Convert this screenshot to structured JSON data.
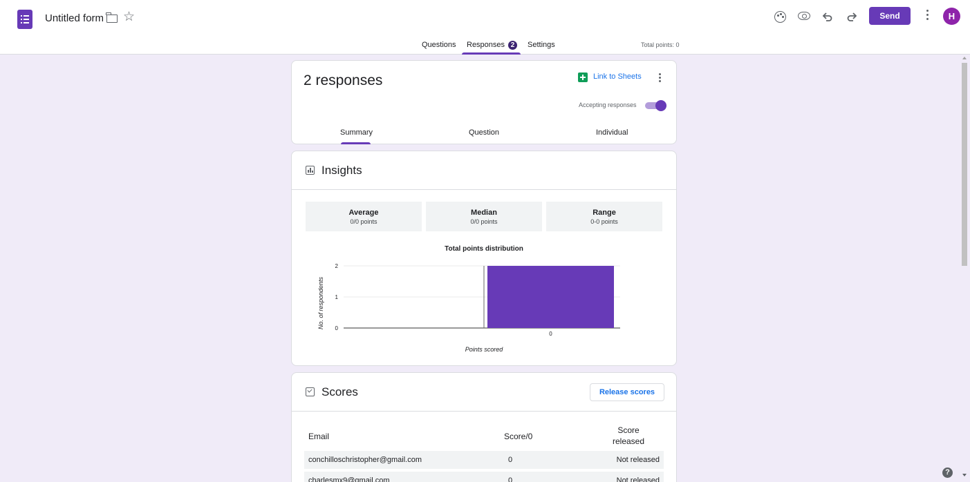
{
  "header": {
    "form_title": "Untitled form",
    "send_label": "Send",
    "avatar_initial": "H"
  },
  "nav": {
    "tabs": [
      "Questions",
      "Responses",
      "Settings"
    ],
    "responses_badge": "2",
    "total_points": "Total points: 0"
  },
  "responses_card": {
    "count_label": "2 responses",
    "link_to_sheets": "Link to Sheets",
    "accepting_label": "Accepting responses",
    "accepting": true,
    "sub_tabs": [
      "Summary",
      "Question",
      "Individual"
    ]
  },
  "insights": {
    "title": "Insights",
    "stats": [
      {
        "label": "Average",
        "value": "0/0 points"
      },
      {
        "label": "Median",
        "value": "0/0 points"
      },
      {
        "label": "Range",
        "value": "0-0 points"
      }
    ]
  },
  "chart_data": {
    "type": "bar",
    "title": "Total points distribution",
    "xlabel": "Points scored",
    "ylabel": "No. of respondents",
    "categories": [
      "0"
    ],
    "values": [
      2
    ],
    "yticks": [
      "0",
      "1",
      "2"
    ],
    "ylim": [
      0,
      2
    ],
    "bar_color": "#673ab7"
  },
  "scores": {
    "title": "Scores",
    "release_label": "Release scores",
    "columns": [
      "Email",
      "Score/0",
      "Score released"
    ],
    "rows": [
      {
        "email": "conchilloschristopher@gmail.com",
        "score": "0",
        "released": "Not released"
      },
      {
        "email": "charlesmx9@gmail.com",
        "score": "0",
        "released": "Not released"
      }
    ]
  },
  "colors": {
    "accent": "#673ab7",
    "background": "#f0ebf8",
    "link": "#1a73e8"
  }
}
